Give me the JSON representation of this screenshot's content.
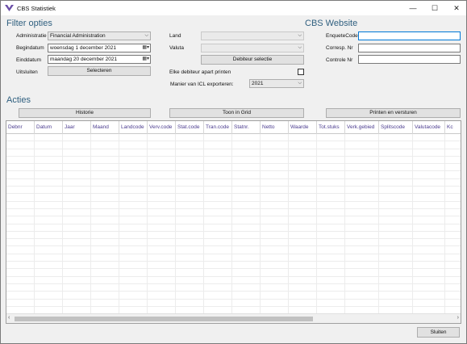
{
  "window": {
    "title": "CBS Statistiek",
    "minimize": "—",
    "maximize": "☐",
    "close": "✕"
  },
  "filter": {
    "heading": "Filter opties",
    "administratie_label": "Administratie",
    "administratie_value": "Financial Administration",
    "begindatum_label": "Begindatum",
    "begindatum_value": "woensdag    1 december 2021",
    "einddatum_label": "Einddatum",
    "einddatum_value": "maandag  20 december 2021",
    "uitsluiten_label": "Uitsluiten",
    "selecteren_button": "Selecteren",
    "land_label": "Land",
    "land_value": "",
    "valuta_label": "Valuta",
    "valuta_value": "",
    "debiteur_selectie_button": "Debiteur selectie",
    "elke_debiteur_label": "Elke debiteur apart printen",
    "elke_debiteur_checked": false,
    "icl_label": "Manier van ICL exporteren:",
    "icl_value": "2021"
  },
  "website": {
    "heading": "CBS Website",
    "enquete_label": "EnqueteCode",
    "enquete_value": "",
    "corresp_label": "Corresp. Nr",
    "corresp_value": "",
    "controle_label": "Controle Nr",
    "controle_value": ""
  },
  "acties": {
    "heading": "Acties",
    "historie_button": "Historie",
    "toon_grid_button": "Toon in Grid",
    "printen_button": "Printen en versturen"
  },
  "grid": {
    "columns": [
      "Debnr",
      "Datum",
      "Jaar",
      "Maand",
      "Landcode",
      "Verv.code",
      "Stat.code",
      "Tran.code",
      "Statnr.",
      "Netto",
      "Waarde",
      "Tot.stuks",
      "Verk.gebied",
      "Splitscode",
      "Valutacode",
      "Kc"
    ],
    "row_count": 24
  },
  "footer": {
    "sluiten_button": "Sluiten"
  },
  "colors": {
    "heading": "#2f5f7f",
    "column_header": "#4b3c8f",
    "focus_border": "#0078d7"
  }
}
